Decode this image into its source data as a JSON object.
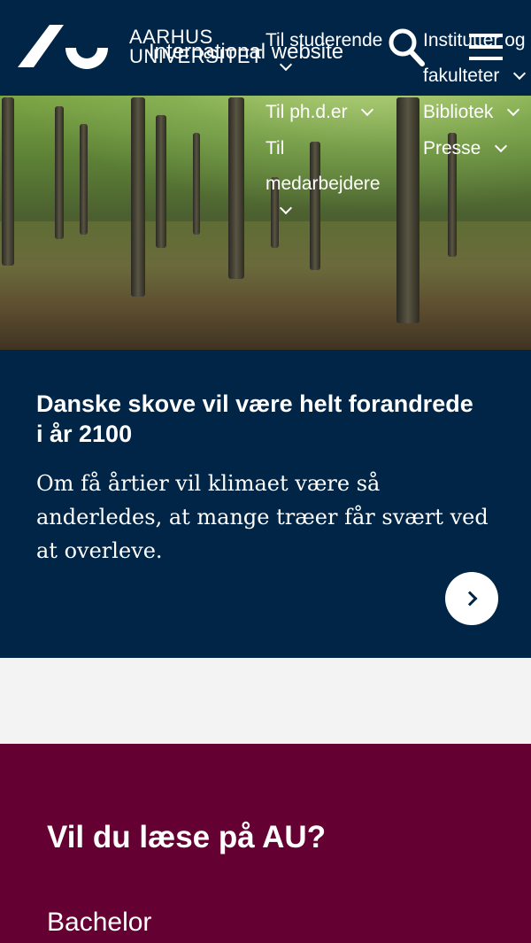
{
  "header": {
    "brand_line1": "AARHUS",
    "brand_line2": "UNIVERSITET",
    "international": "International website",
    "nav": [
      {
        "label": "Til studerende"
      },
      {
        "label": "Institutter og fakulteter"
      },
      {
        "label": "Til ph.d.er"
      },
      {
        "label": "Bibliotek"
      },
      {
        "label": "Til medarbejdere"
      },
      {
        "label": "Presse"
      }
    ],
    "search_icon": "search-icon",
    "menu_icon": "hamburger-menu-icon"
  },
  "story": {
    "title": "Danske skove vil være helt forandrede i år 2100",
    "teaser": "Om få årtier vil klimaet være så anderledes, at mange træer får svært ved at overleve.",
    "arrow_icon": "chevron-right-icon"
  },
  "study": {
    "heading": "Vil du læse på AU?",
    "items": [
      "Bachelor"
    ]
  },
  "colors": {
    "header_bg": "#002546",
    "study_bg": "#650032",
    "gap_bg": "#f3f3f3"
  }
}
